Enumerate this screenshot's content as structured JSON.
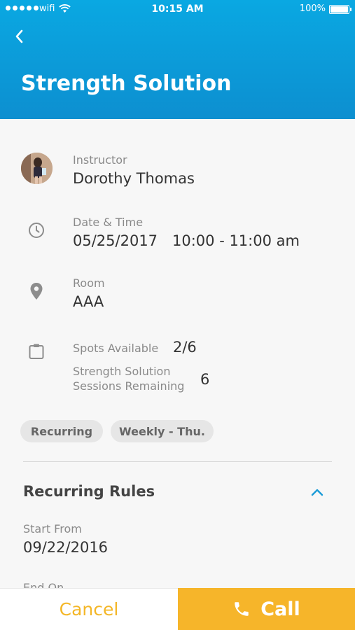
{
  "status_bar": {
    "carrier": "wifi",
    "time": "10:15 AM",
    "battery": "100%"
  },
  "header": {
    "title": "Strength Solution"
  },
  "instructor": {
    "label": "Instructor",
    "name": "Dorothy Thomas"
  },
  "datetime": {
    "label": "Date & Time",
    "date": "05/25/2017",
    "time": "10:00 - 11:00 am"
  },
  "room": {
    "label": "Room",
    "value": "AAA"
  },
  "spots": {
    "label": "Spots Available",
    "value": "2/6",
    "sessions_label_line1": "Strength Solution",
    "sessions_label_line2": "Sessions Remaining",
    "sessions_value": "6"
  },
  "tags": [
    "Recurring",
    "Weekly - Thu."
  ],
  "recurring_rules": {
    "title": "Recurring Rules",
    "start_label": "Start From",
    "start_value": "09/22/2016",
    "end_label": "End On"
  },
  "footer": {
    "cancel_label": "Cancel",
    "call_label": "Call"
  },
  "colors": {
    "header": "#0d9ad8",
    "accent_yellow": "#f6b52a",
    "chevron": "#1a9bd7"
  }
}
